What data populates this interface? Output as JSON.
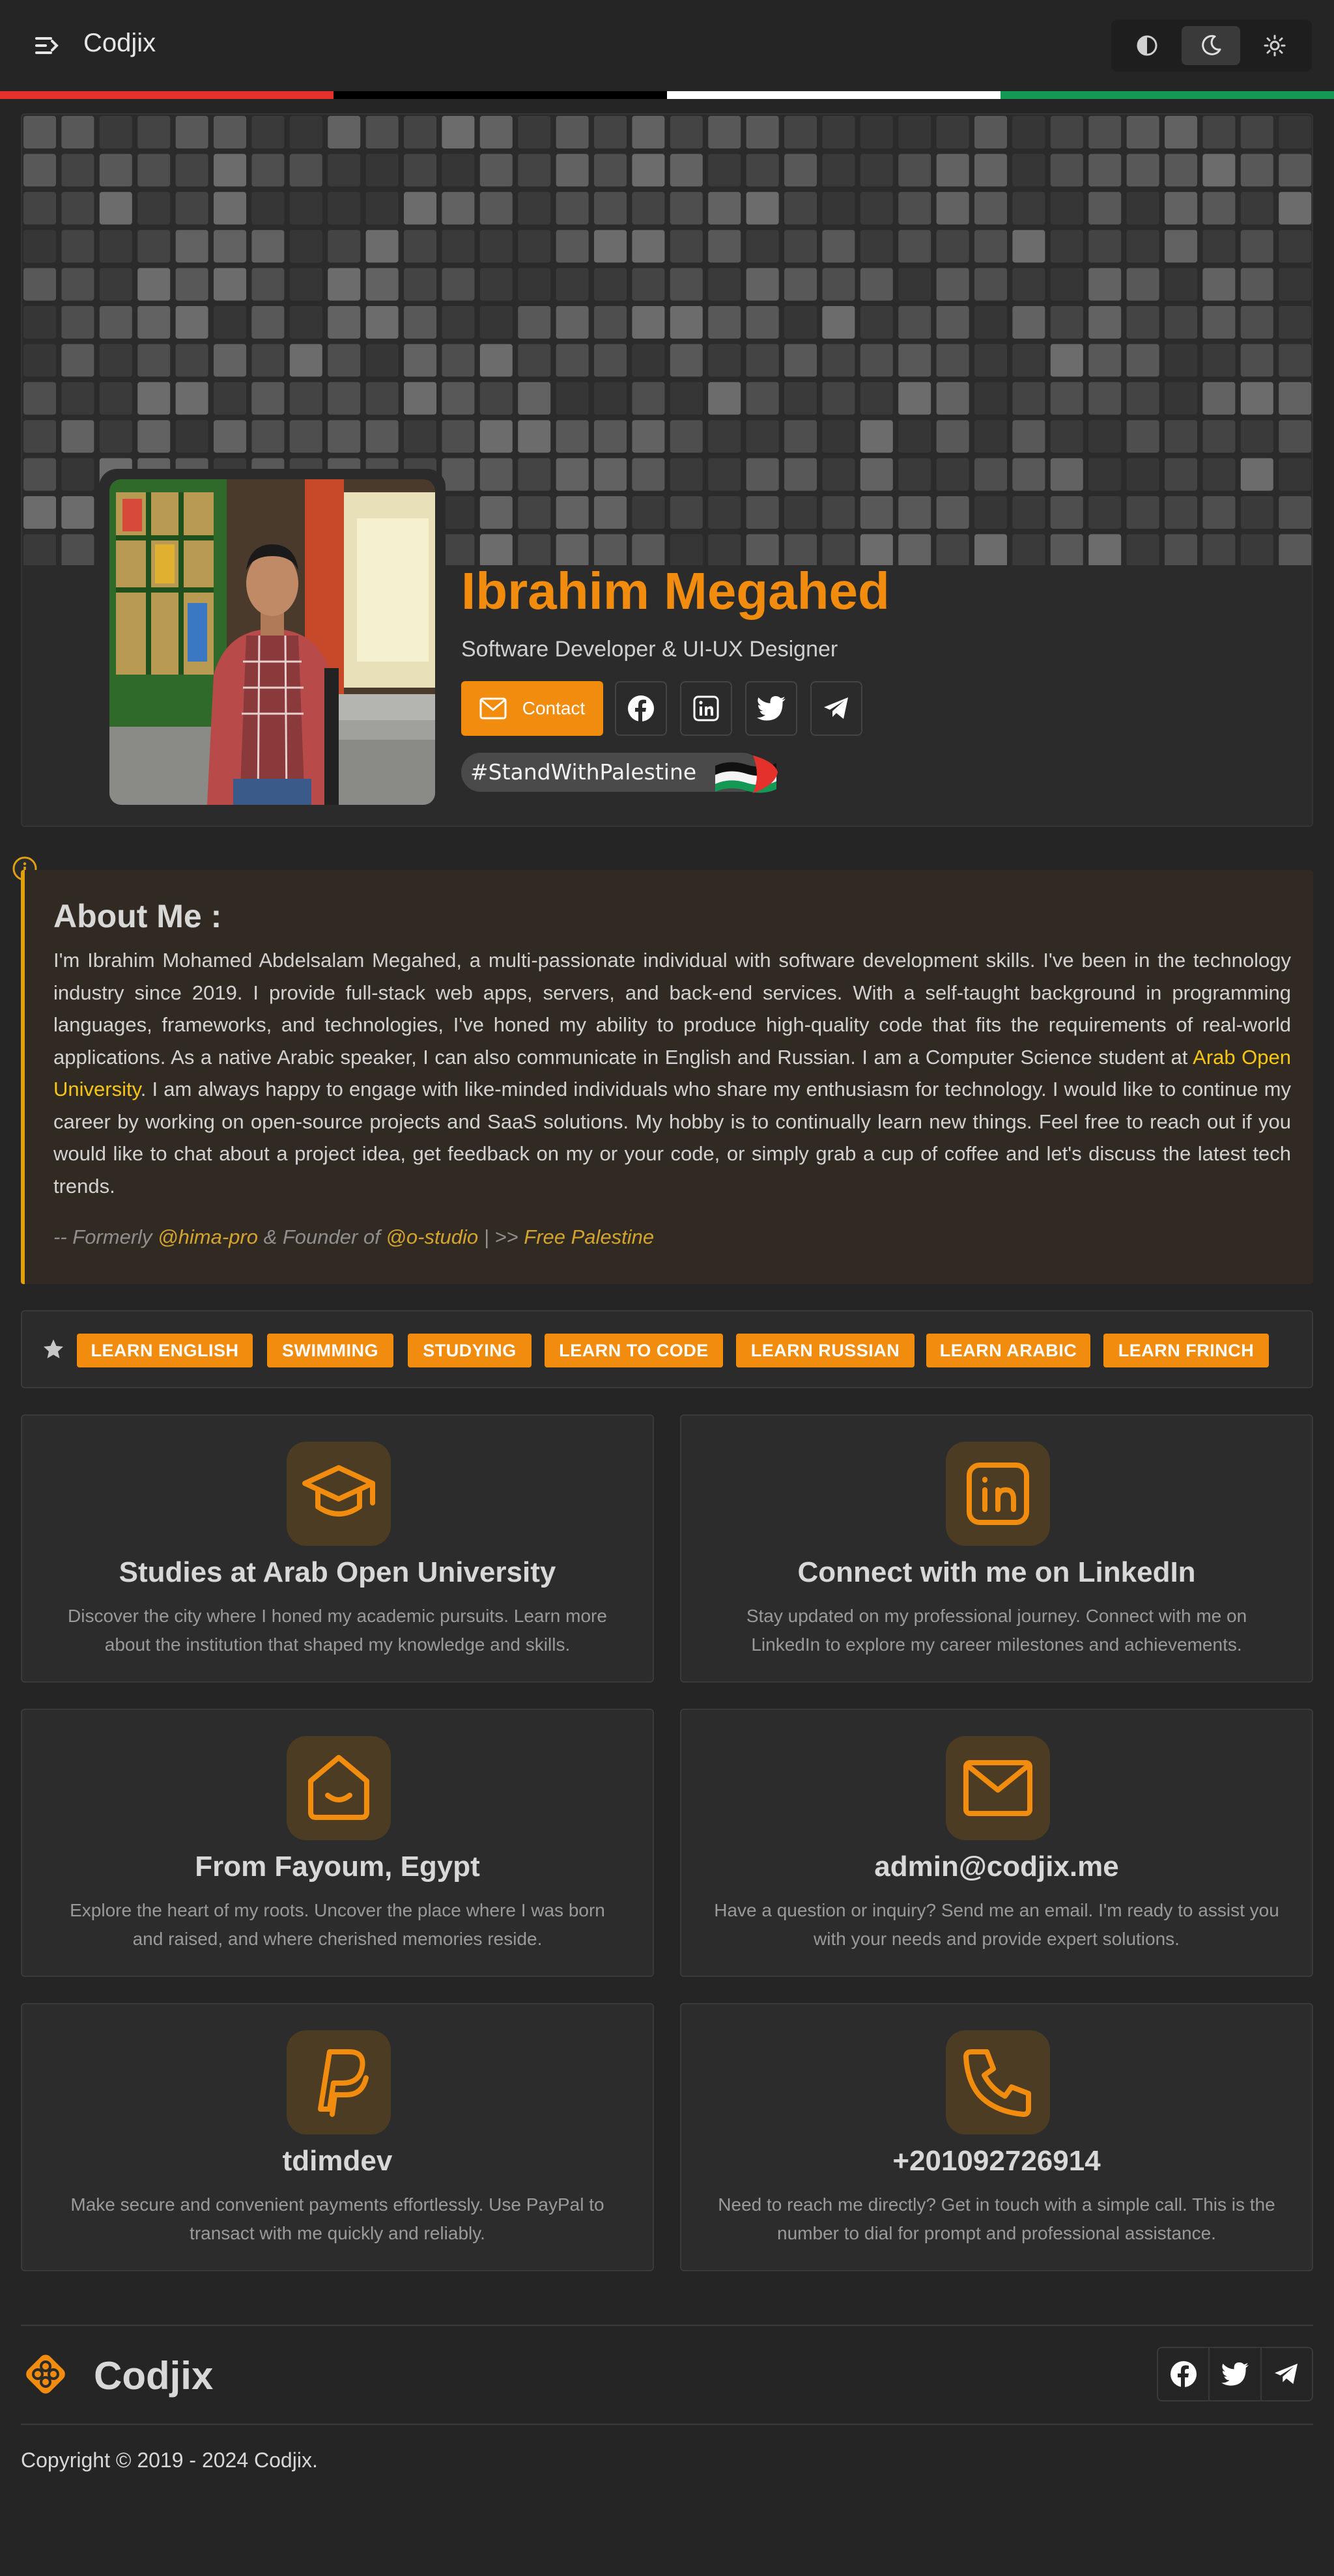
{
  "header": {
    "brand": "Codjix",
    "theme_options": [
      "auto-theme-icon",
      "moon-icon",
      "sun-icon"
    ],
    "active_theme": "dark"
  },
  "colors": {
    "accent": "#f28c0f",
    "highlight": "#f5c518",
    "flag_red": "#e4312b",
    "flag_black": "#000000",
    "flag_white": "#ffffff",
    "flag_green": "#149954"
  },
  "hero": {
    "name": "Ibrahim Megahed",
    "role": "Software Developer & UI-UX Designer",
    "contact_label": "Contact",
    "social_icons": [
      "facebook-icon",
      "linkedin-icon",
      "twitter-icon",
      "telegram-icon"
    ],
    "campaign": "#StandWithPalestine"
  },
  "about": {
    "title": "About Me :",
    "body_start": "I'm Ibrahim Mohamed Abdelsalam Megahed, a multi-passionate individual with software development skills. I've been in the technology industry since 2019. I provide full-stack web apps, servers, and back-end services. With a self-taught background in programming languages, frameworks, and technologies, I've honed my ability to produce high-quality code that fits the requirements of real-world applications. As a native Arabic speaker, I can also communicate in English and Russian. I am a Computer Science student at ",
    "university_link": "Arab Open University",
    "body_end": ". I am always happy to engage with like-minded individuals who share my enthusiasm for technology. I would like to continue my career by working on open-source projects and SaaS solutions. My hobby is to continually learn new things. Feel free to reach out if you would like to chat about a project idea, get feedback on my or your code, or simply grab a cup of coffee and let's discuss the latest tech trends.",
    "sign_prefix": "-- Formerly ",
    "sign_handle1": "@hima-pro",
    "sign_mid": " & Founder of ",
    "sign_handle2": "@o-studio",
    "sign_sep": " | >> ",
    "sign_free": "Free Palestine"
  },
  "hobbies": [
    "LEARN ENGLISH",
    "SWIMMING",
    "STUDYING",
    "LEARN TO CODE",
    "LEARN RUSSIAN",
    "LEARN ARABIC",
    "LEARN FRINCH"
  ],
  "cards": [
    {
      "icon": "graduation-cap-icon",
      "title": "Studies at Arab Open University",
      "desc": "Discover the city where I honed my academic pursuits. Learn more about the institution that shaped my knowledge and skills."
    },
    {
      "icon": "linkedin-icon",
      "title": "Connect with me on LinkedIn",
      "desc": "Stay updated on my professional journey. Connect with me on LinkedIn to explore my career milestones and achievements."
    },
    {
      "icon": "home-icon",
      "title": "From Fayoum, Egypt",
      "desc": "Explore the heart of my roots. Uncover the place where I was born and raised, and where cherished memories reside."
    },
    {
      "icon": "mail-icon",
      "title": "admin@codjix.me",
      "desc": "Have a question or inquiry? Send me an email. I'm ready to assist you with your needs and provide expert solutions."
    },
    {
      "icon": "paypal-icon",
      "title": "tdimdev",
      "desc": "Make secure and convenient payments effortlessly. Use PayPal to transact with me quickly and reliably."
    },
    {
      "icon": "phone-icon",
      "title": "+201092726914",
      "desc": "Need to reach me directly? Get in touch with a simple call. This is the number to dial for prompt and professional assistance."
    }
  ],
  "footer": {
    "brand": "Codjix",
    "social_icons": [
      "facebook-icon",
      "twitter-icon",
      "telegram-icon"
    ],
    "copyright": "Copyright © 2019 - 2024 Codjix."
  }
}
